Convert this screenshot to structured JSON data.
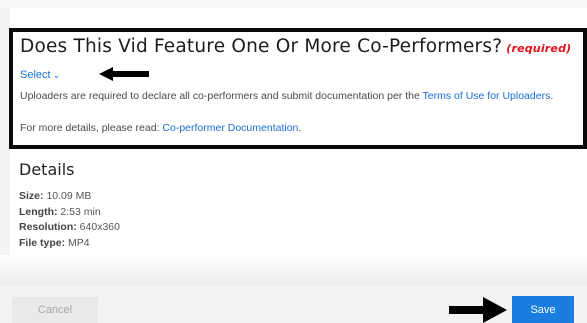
{
  "question": {
    "title": "Does This Vid Feature One Or More Co-Performers?",
    "required_label": "(required)",
    "select_label": "Select",
    "info_text_1": "Uploaders are required to declare all co-performers and submit documentation per the ",
    "terms_link": "Terms of Use for Uploaders",
    "info_text_1_end": ".",
    "info_text_2": "For more details, please read: ",
    "doc_link": "Co-performer Documentation",
    "info_text_2_end": "."
  },
  "details": {
    "heading": "Details",
    "rows": [
      {
        "label": "Size:",
        "value": "10.09 MB"
      },
      {
        "label": "Length:",
        "value": "2:53 min"
      },
      {
        "label": "Resolution:",
        "value": "640x360"
      },
      {
        "label": "File type:",
        "value": "MP4"
      }
    ]
  },
  "footer": {
    "cancel_label": "Cancel",
    "save_label": "Save"
  },
  "colors": {
    "accent": "#1a7ee0",
    "required": "#e0141c",
    "highlight_border": "#0a0a0a"
  }
}
